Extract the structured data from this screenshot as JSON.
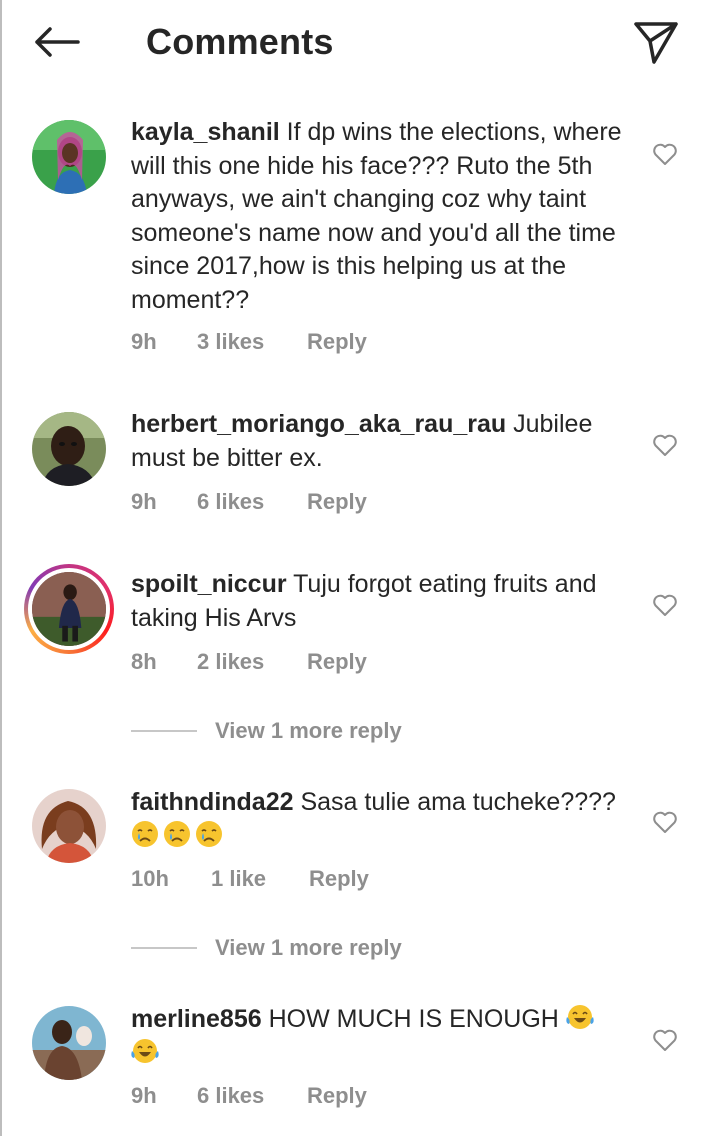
{
  "header": {
    "title": "Comments",
    "back_icon": "arrow-left-icon",
    "share_icon": "paper-plane-icon"
  },
  "comments": [
    {
      "username": "kayla_shanil",
      "text": " If dp wins the elections, where will this one hide his face??? Ruto the 5th anyways, we ain't changing coz why taint someone's name now and you'd all the time since 2017,how is this helping us at the moment??",
      "time": "9h",
      "likes": "3 likes",
      "reply": "Reply"
    },
    {
      "username": "herbert_moriango_aka_rau_rau",
      "text": " Jubilee must be bitter ex.",
      "time": "9h",
      "likes": "6 likes",
      "reply": "Reply"
    },
    {
      "username": "spoilt_niccur",
      "text": " Tuju forgot eating fruits and taking His Arvs",
      "time": "8h",
      "likes": "2 likes",
      "reply": "Reply",
      "view_more": "View 1 more reply"
    },
    {
      "username": "faithndinda22",
      "text": " Sasa tulie ama tucheke????",
      "emoji": "crying-face-emoji",
      "emoji_count": 3,
      "time": "10h",
      "likes": "1 like",
      "reply": "Reply",
      "view_more": "View 1 more reply"
    },
    {
      "username": "merline856",
      "text": " HOW MUCH IS ENOUGH ",
      "emoji": "tears-of-joy-emoji",
      "emoji_count": 2,
      "time": "9h",
      "likes": "6 likes",
      "reply": "Reply"
    }
  ],
  "colors": {
    "text": "#262626",
    "secondary": "#8e8e8e",
    "story_ring": "#e1306c"
  }
}
